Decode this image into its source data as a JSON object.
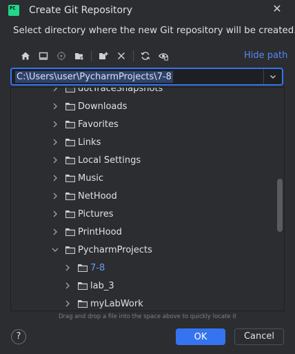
{
  "window": {
    "app_icon_text": "PC",
    "title": "Create Git Repository",
    "close_glyph": "✕"
  },
  "description": "Select directory where the new Git repository will be created.",
  "toolbar": {
    "buttons": [
      "home-icon",
      "desktop-icon",
      "project-icon",
      "module-icon",
      "new-folder-icon",
      "delete-icon",
      "refresh-icon",
      "show-hidden-icon"
    ],
    "hide_path_label": "Hide path"
  },
  "path_field": {
    "value": "C:\\Users\\user\\PycharmProjects\\7-8"
  },
  "tree": {
    "items": [
      {
        "label": "dotTraceSnapshots",
        "expanded": false,
        "selected": false
      },
      {
        "label": "Downloads",
        "expanded": false,
        "selected": false
      },
      {
        "label": "Favorites",
        "expanded": false,
        "selected": false
      },
      {
        "label": "Links",
        "expanded": false,
        "selected": false
      },
      {
        "label": "Local Settings",
        "expanded": false,
        "selected": false
      },
      {
        "label": "Music",
        "expanded": false,
        "selected": false
      },
      {
        "label": "NetHood",
        "expanded": false,
        "selected": false
      },
      {
        "label": "Pictures",
        "expanded": false,
        "selected": false
      },
      {
        "label": "PrintHood",
        "expanded": false,
        "selected": false
      },
      {
        "label": "PycharmProjects",
        "expanded": true,
        "selected": false
      },
      {
        "label": "7-8",
        "expanded": false,
        "selected": true
      },
      {
        "label": "lab_3",
        "expanded": false,
        "selected": false
      },
      {
        "label": "myLabWork",
        "expanded": false,
        "selected": false
      }
    ]
  },
  "hint": "Drag and drop a file into the space above to quickly locate it",
  "footer": {
    "help_label": "?",
    "ok_label": "OK",
    "cancel_label": "Cancel"
  },
  "colors": {
    "background": "#2b2d30",
    "accent": "#3574f0",
    "link": "#548af7",
    "selected_text": "#6b9bf2"
  }
}
